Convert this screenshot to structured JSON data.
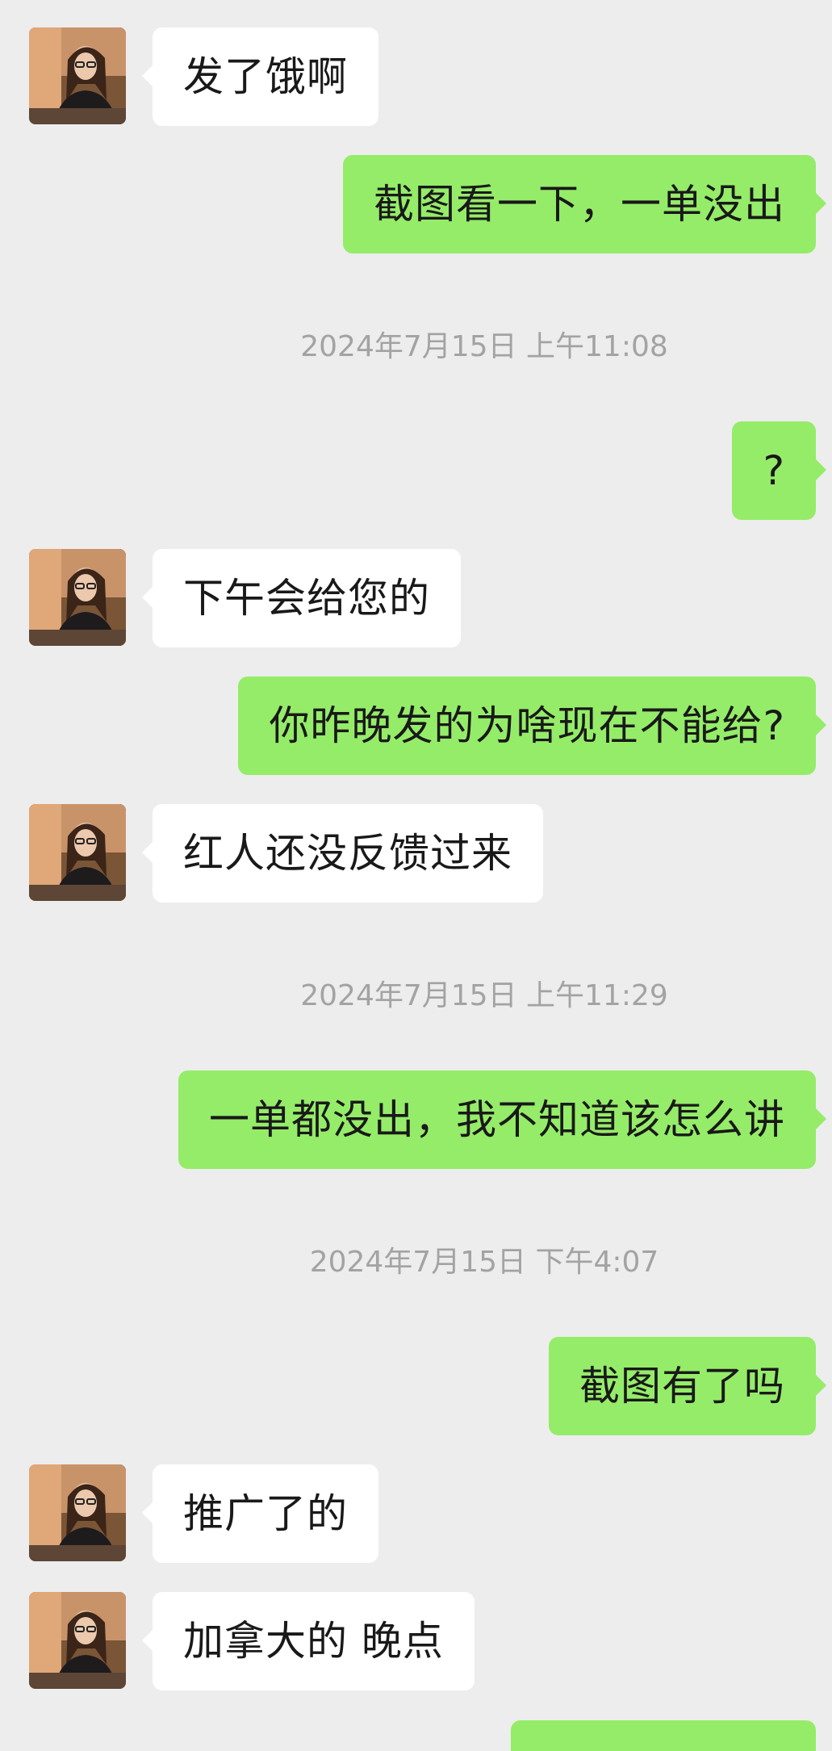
{
  "colors": {
    "background": "#ededed",
    "incoming_bubble": "#ffffff",
    "outgoing_bubble": "#95ec69",
    "timestamp_text": "#a3a3a3"
  },
  "avatar_icon": "contact-photo",
  "messages": [
    {
      "type": "in",
      "text": "发了饿啊"
    },
    {
      "type": "out",
      "text": "截图看一下，一单没出"
    },
    {
      "type": "time",
      "text": "2024年7月15日 上午11:08"
    },
    {
      "type": "out",
      "text": "?"
    },
    {
      "type": "in",
      "text": "下午会给您的"
    },
    {
      "type": "out",
      "text": "你昨晚发的为啥现在不能给?"
    },
    {
      "type": "in",
      "text": "红人还没反馈过来"
    },
    {
      "type": "time",
      "text": "2024年7月15日 上午11:29"
    },
    {
      "type": "out",
      "text": "一单都没出，我不知道该怎么讲"
    },
    {
      "type": "time",
      "text": "2024年7月15日 下午4:07"
    },
    {
      "type": "out",
      "text": "截图有了吗"
    },
    {
      "type": "in",
      "text": "推广了的"
    },
    {
      "type": "in",
      "text": "加拿大的 晚点"
    }
  ]
}
